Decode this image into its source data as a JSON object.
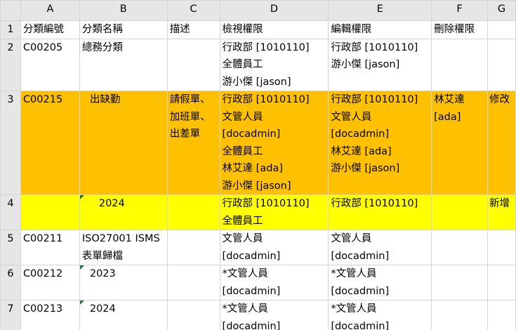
{
  "columns": [
    "A",
    "B",
    "C",
    "D",
    "E",
    "F",
    "G"
  ],
  "rows": {
    "r1": {
      "num": "1",
      "a": "分類編號",
      "b": "分類名稱",
      "c": "描述",
      "d": "檢視權限",
      "e": "編輯權限",
      "f": "刪除權限",
      "g": ""
    },
    "r2": {
      "num": "2",
      "a": "C00205",
      "b": "總務分類",
      "c": "",
      "d": "行政部 [1010110]\n全體員工\n游小傑 [jason]",
      "e": "行政部 [1010110]\n游小傑 [jason]",
      "f": "",
      "g": ""
    },
    "r3": {
      "num": "3",
      "a": "C00215",
      "b": "出缺勤",
      "c": "請假單、\n加班單、\n出差單",
      "d": "行政部 [1010110]\n文管人員\n[docadmin]\n全體員工\n林艾達 [ada]\n游小傑 [jason]",
      "e": "行政部 [1010110]\n文管人員\n[docadmin]\n林艾達 [ada]\n游小傑 [jason]",
      "f": "林艾達\n[ada]",
      "g": "修改"
    },
    "r4": {
      "num": "4",
      "a": "",
      "b": "2024",
      "c": "",
      "d": "行政部 [1010110]\n全體員工",
      "e": "行政部 [1010110]",
      "f": "",
      "g": "新增"
    },
    "r5": {
      "num": "5",
      "a": "C00211",
      "b": "ISO27001 ISMS\n表單歸檔",
      "c": "",
      "d": "文管人員\n[docadmin]",
      "e": "文管人員\n[docadmin]",
      "f": "",
      "g": ""
    },
    "r6": {
      "num": "6",
      "a": "C00212",
      "b": "2023",
      "c": "",
      "d": "*文管人員\n[docadmin]",
      "e": "*文管人員\n[docadmin]",
      "f": "",
      "g": ""
    },
    "r7": {
      "num": "7",
      "a": "C00213",
      "b": "2024",
      "c": "",
      "d": "*文管人員\n[docadmin]",
      "e": "*文管人員\n[docadmin]",
      "f": "",
      "g": ""
    }
  },
  "colors": {
    "row3_fill": "#ffc000",
    "row4_fill": "#ffff00",
    "header_text": "#1a3fd1",
    "comment_marker": "#1e7b34"
  }
}
